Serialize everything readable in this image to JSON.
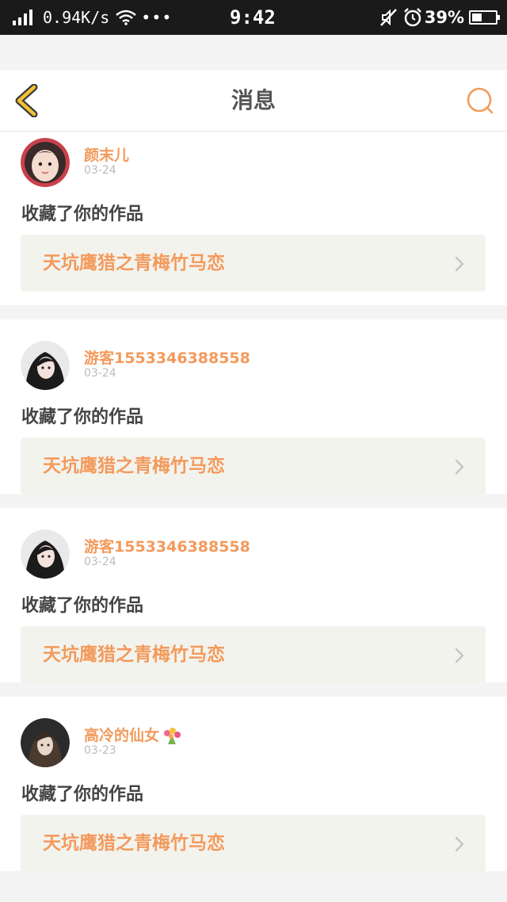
{
  "status_bar": {
    "net_speed": "0.94K/s",
    "time": "9:42",
    "battery_percent": "39%",
    "battery_level": 0.39,
    "icons": [
      "signal-icon",
      "wifi-icon",
      "more-dots-icon",
      "mute-icon",
      "alarm-icon",
      "battery-icon"
    ]
  },
  "header": {
    "title": "消息",
    "back_icon": "chevron-left-icon",
    "search_icon": "search-icon"
  },
  "colors": {
    "accent": "#f39a5c",
    "back_arrow": "#f2c232",
    "card_bg": "#f3f3ee"
  },
  "messages": [
    {
      "username": "颜末儿",
      "date": "03-24",
      "action": "收藏了你的作品",
      "work_title": "天坑鹰猎之青梅竹马恋",
      "avatar": "avatar-icon"
    },
    {
      "username": "游客1553346388558",
      "date": "03-24",
      "action": "收藏了你的作品",
      "work_title": "天坑鹰猎之青梅竹马恋",
      "avatar": "avatar-icon"
    },
    {
      "username": "游客1553346388558",
      "date": "03-24",
      "action": "收藏了你的作品",
      "work_title": "天坑鹰猎之青梅竹马恋",
      "avatar": "avatar-icon"
    },
    {
      "username": "高冷的仙女",
      "date": "03-23",
      "action": "收藏了你的作品",
      "work_title": "天坑鹰猎之青梅竹马恋",
      "avatar": "avatar-icon",
      "username_emoji": "flower-bouquet-icon"
    }
  ]
}
